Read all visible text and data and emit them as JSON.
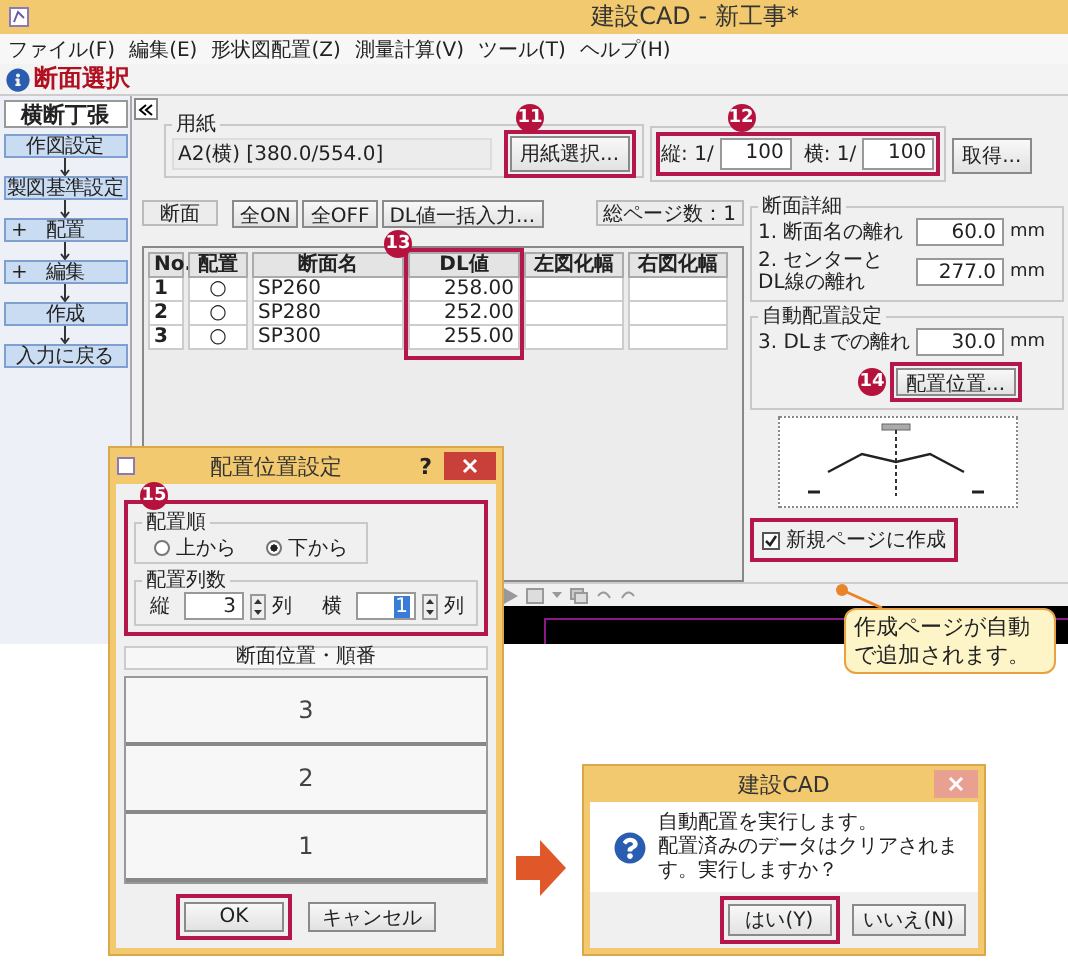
{
  "window": {
    "title": "建設CAD - 新工事*"
  },
  "menu": [
    "ファイル(F)",
    "編集(E)",
    "形状図配置(Z)",
    "測量計算(V)",
    "ツール(T)",
    "ヘルプ(H)"
  ],
  "header": {
    "title": "断面選択"
  },
  "sidebar": {
    "tab": "横断丁張",
    "items": [
      {
        "label": "作図設定"
      },
      {
        "label": "製図基準設定"
      },
      {
        "label": "配置",
        "marker": "+"
      },
      {
        "label": "編集",
        "marker": "+"
      },
      {
        "label": "作成"
      },
      {
        "label": "入力に戻る"
      }
    ]
  },
  "paper": {
    "title": "用紙",
    "value": "A2(横) [380.0/554.0]",
    "button": "用紙選択..."
  },
  "scale": {
    "vertical_label": "縦: 1/",
    "vertical": "100",
    "horizontal_label": "横: 1/",
    "horizontal": "100",
    "button": "取得..."
  },
  "list_toolbar": {
    "section_label": "断面",
    "buttons": [
      "全ON",
      "全OFF",
      "DL値一括入力..."
    ],
    "page_count": "総ページ数：1"
  },
  "table": {
    "columns": [
      "No.",
      "配置",
      "断面名",
      "DL値",
      "左図化幅",
      "右図化幅"
    ],
    "rows": [
      {
        "cells": [
          "1",
          "○",
          "SP260",
          "258.00"
        ]
      },
      {
        "cells": [
          "2",
          "○",
          "SP280",
          "252.00"
        ]
      },
      {
        "cells": [
          "3",
          "○",
          "SP300",
          "255.00"
        ]
      }
    ]
  },
  "section_detail": {
    "title": "断面詳細",
    "fields": [
      {
        "label_lines": [
          "1. 断面名の離れ"
        ],
        "value": "60.0",
        "unit": "mm"
      },
      {
        "label_lines": [
          "2. センターと",
          "DL線の離れ"
        ],
        "value": "277.0",
        "unit": "mm"
      }
    ]
  },
  "auto_layout": {
    "title": "自動配置設定",
    "field": {
      "label_lines": [
        "3. DLまでの離れ"
      ],
      "value": "30.0",
      "unit": "mm"
    },
    "button": "配置位置..."
  },
  "new_page": {
    "label": "新規ページに作成",
    "checked": true,
    "highlighted": true
  },
  "callout": {
    "lines": [
      "作成ページが自動",
      "で追加されます。"
    ]
  },
  "annotations": [
    {
      "badge": "11"
    },
    {
      "badge": "12"
    },
    {
      "badge": "13"
    },
    {
      "badge": "14"
    },
    {
      "badge": "15"
    }
  ],
  "layout_dialog": {
    "title": "配置位置設定",
    "help": "?",
    "order": {
      "title": "配置順",
      "options": [
        {
          "label": "上から",
          "selected": false
        },
        {
          "label": "下から",
          "selected": true
        }
      ]
    },
    "columns": {
      "title": "配置列数",
      "vertical_label": "縦",
      "vertical": "3",
      "vertical_selected": false,
      "vertical_unit": "列",
      "horizontal_label": "横",
      "horizontal": "1",
      "horizontal_selected": true,
      "horizontal_unit": "列"
    },
    "preview_title": "断面位置・順番",
    "slots": [
      "3",
      "2",
      "1"
    ],
    "buttons": [
      {
        "label": "OK",
        "highlighted": true
      },
      {
        "label": "キャンセル",
        "highlighted": false
      }
    ]
  },
  "confirm_dialog": {
    "title": "建設CAD",
    "lines": [
      "自動配置を実行します。",
      "配置済みのデータはクリアされます。実行しますか？"
    ],
    "buttons": [
      {
        "label": "はい(Y)",
        "highlighted": true
      },
      {
        "label": "いいえ(N)",
        "highlighted": false
      }
    ]
  }
}
